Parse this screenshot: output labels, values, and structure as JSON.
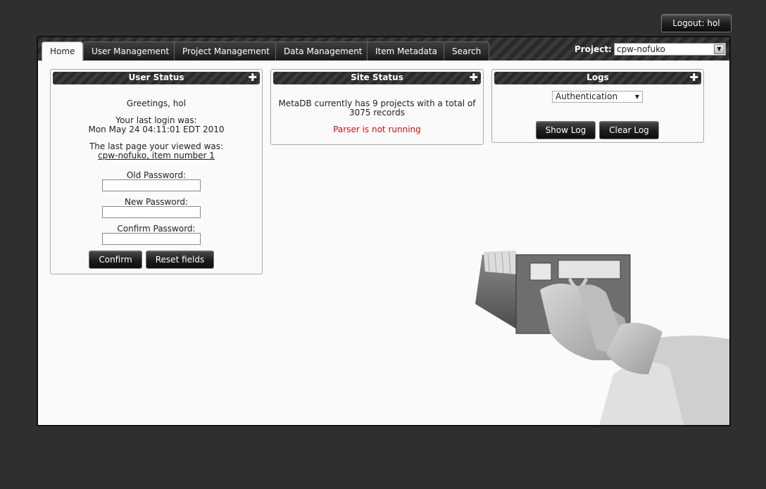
{
  "header": {
    "logout_label": "Logout: hol"
  },
  "tabs": [
    {
      "label": "Home"
    },
    {
      "label": "User Management"
    },
    {
      "label": "Project Management"
    },
    {
      "label": "Data Management"
    },
    {
      "label": "Item Metadata"
    },
    {
      "label": "Search"
    }
  ],
  "project": {
    "label": "Project:",
    "selected": "cpw-nofuko"
  },
  "user_status": {
    "title": "User Status",
    "greeting": "Greetings, hol",
    "last_login_label": "Your last login was:",
    "last_login_value": "Mon May 24 04:11:01 EDT 2010",
    "last_page_label": "The last page your viewed was:",
    "last_page_link": "cpw-nofuko, item number 1",
    "old_password_label": "Old Password:",
    "new_password_label": "New Password:",
    "confirm_password_label": "Confirm Password:",
    "confirm_button": "Confirm",
    "reset_button": "Reset fields"
  },
  "site_status": {
    "title": "Site Status",
    "summary_line1": "MetaDB currently has 9 projects with a total of",
    "summary_line2": "3075 records",
    "parser_status": "Parser is not running",
    "parser_status_color": "#cc1111"
  },
  "logs": {
    "title": "Logs",
    "log_type_selected": "Authentication",
    "show_log_button": "Show Log",
    "clear_log_button": "Clear Log"
  },
  "icons": {
    "panel_expand": "plus-icon",
    "dropdown": "chevron-down-icon"
  }
}
